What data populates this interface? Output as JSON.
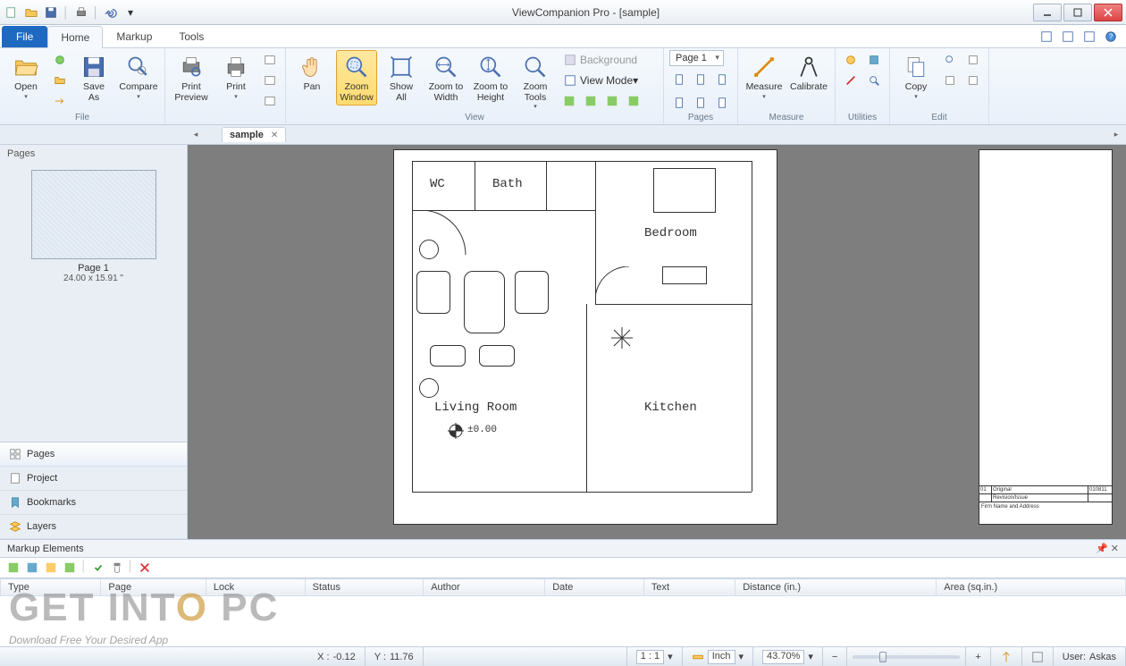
{
  "window": {
    "title": "ViewCompanion Pro - [sample]"
  },
  "ribbon": {
    "file_tab": "File",
    "tabs": [
      "Home",
      "Markup",
      "Tools"
    ],
    "active_tab": "Home",
    "groups": {
      "file": {
        "label": "File",
        "open": "Open",
        "save_as": "Save\nAs",
        "compare": "Compare"
      },
      "print": {
        "print_preview": "Print\nPreview",
        "print": "Print"
      },
      "view": {
        "label": "View",
        "pan": "Pan",
        "zoom_window": "Zoom\nWindow",
        "show_all": "Show\nAll",
        "zoom_width": "Zoom to\nWidth",
        "zoom_height": "Zoom to\nHeight",
        "zoom_tools": "Zoom\nTools",
        "background": "Background",
        "view_mode": "View Mode"
      },
      "pages": {
        "label": "Pages",
        "selector": "Page 1"
      },
      "measure": {
        "label": "Measure",
        "measure": "Measure",
        "calibrate": "Calibrate"
      },
      "utilities": {
        "label": "Utilities"
      },
      "edit": {
        "label": "Edit",
        "copy": "Copy"
      }
    }
  },
  "doctab": {
    "name": "sample"
  },
  "side": {
    "header": "Pages",
    "thumb_label": "Page 1",
    "thumb_dims": "24.00 x 15.91 \"",
    "nav": [
      "Pages",
      "Project",
      "Bookmarks",
      "Layers"
    ]
  },
  "floorplan": {
    "wc": "WC",
    "bath": "Bath",
    "bedroom": "Bedroom",
    "living": "Living Room",
    "kitchen": "Kitchen",
    "origin": "±0.00",
    "revblock": {
      "r1c1": "01",
      "r1c2": "Original",
      "r1c3": "010811",
      "h2": "Revision/Issue",
      "foot": "Firm Name and Address"
    }
  },
  "markup": {
    "title": "Markup Elements",
    "columns": [
      "Type",
      "Page",
      "Lock",
      "Status",
      "Author",
      "Date",
      "Text",
      "Distance (in.)",
      "Area (sq.in.)"
    ]
  },
  "status": {
    "x_label": "X :",
    "x_val": "-0.12",
    "y_label": "Y :",
    "y_val": "11.76",
    "ratio": "1 : 1",
    "unit": "Inch",
    "zoom": "43.70%",
    "user_label": "User:",
    "user": "Askas"
  },
  "watermark": {
    "a": "GET INT",
    "b": "O",
    "c": " PC",
    "sub": "Download Free Your Desired App"
  }
}
